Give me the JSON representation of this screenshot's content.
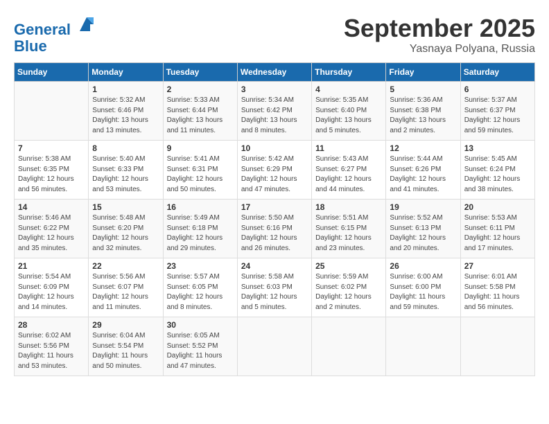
{
  "header": {
    "logo_line1": "General",
    "logo_line2": "Blue",
    "month": "September 2025",
    "location": "Yasnaya Polyana, Russia"
  },
  "days_of_week": [
    "Sunday",
    "Monday",
    "Tuesday",
    "Wednesday",
    "Thursday",
    "Friday",
    "Saturday"
  ],
  "weeks": [
    [
      {
        "day": "",
        "info": ""
      },
      {
        "day": "1",
        "info": "Sunrise: 5:32 AM\nSunset: 6:46 PM\nDaylight: 13 hours\nand 13 minutes."
      },
      {
        "day": "2",
        "info": "Sunrise: 5:33 AM\nSunset: 6:44 PM\nDaylight: 13 hours\nand 11 minutes."
      },
      {
        "day": "3",
        "info": "Sunrise: 5:34 AM\nSunset: 6:42 PM\nDaylight: 13 hours\nand 8 minutes."
      },
      {
        "day": "4",
        "info": "Sunrise: 5:35 AM\nSunset: 6:40 PM\nDaylight: 13 hours\nand 5 minutes."
      },
      {
        "day": "5",
        "info": "Sunrise: 5:36 AM\nSunset: 6:38 PM\nDaylight: 13 hours\nand 2 minutes."
      },
      {
        "day": "6",
        "info": "Sunrise: 5:37 AM\nSunset: 6:37 PM\nDaylight: 12 hours\nand 59 minutes."
      }
    ],
    [
      {
        "day": "7",
        "info": "Sunrise: 5:38 AM\nSunset: 6:35 PM\nDaylight: 12 hours\nand 56 minutes."
      },
      {
        "day": "8",
        "info": "Sunrise: 5:40 AM\nSunset: 6:33 PM\nDaylight: 12 hours\nand 53 minutes."
      },
      {
        "day": "9",
        "info": "Sunrise: 5:41 AM\nSunset: 6:31 PM\nDaylight: 12 hours\nand 50 minutes."
      },
      {
        "day": "10",
        "info": "Sunrise: 5:42 AM\nSunset: 6:29 PM\nDaylight: 12 hours\nand 47 minutes."
      },
      {
        "day": "11",
        "info": "Sunrise: 5:43 AM\nSunset: 6:27 PM\nDaylight: 12 hours\nand 44 minutes."
      },
      {
        "day": "12",
        "info": "Sunrise: 5:44 AM\nSunset: 6:26 PM\nDaylight: 12 hours\nand 41 minutes."
      },
      {
        "day": "13",
        "info": "Sunrise: 5:45 AM\nSunset: 6:24 PM\nDaylight: 12 hours\nand 38 minutes."
      }
    ],
    [
      {
        "day": "14",
        "info": "Sunrise: 5:46 AM\nSunset: 6:22 PM\nDaylight: 12 hours\nand 35 minutes."
      },
      {
        "day": "15",
        "info": "Sunrise: 5:48 AM\nSunset: 6:20 PM\nDaylight: 12 hours\nand 32 minutes."
      },
      {
        "day": "16",
        "info": "Sunrise: 5:49 AM\nSunset: 6:18 PM\nDaylight: 12 hours\nand 29 minutes."
      },
      {
        "day": "17",
        "info": "Sunrise: 5:50 AM\nSunset: 6:16 PM\nDaylight: 12 hours\nand 26 minutes."
      },
      {
        "day": "18",
        "info": "Sunrise: 5:51 AM\nSunset: 6:15 PM\nDaylight: 12 hours\nand 23 minutes."
      },
      {
        "day": "19",
        "info": "Sunrise: 5:52 AM\nSunset: 6:13 PM\nDaylight: 12 hours\nand 20 minutes."
      },
      {
        "day": "20",
        "info": "Sunrise: 5:53 AM\nSunset: 6:11 PM\nDaylight: 12 hours\nand 17 minutes."
      }
    ],
    [
      {
        "day": "21",
        "info": "Sunrise: 5:54 AM\nSunset: 6:09 PM\nDaylight: 12 hours\nand 14 minutes."
      },
      {
        "day": "22",
        "info": "Sunrise: 5:56 AM\nSunset: 6:07 PM\nDaylight: 12 hours\nand 11 minutes."
      },
      {
        "day": "23",
        "info": "Sunrise: 5:57 AM\nSunset: 6:05 PM\nDaylight: 12 hours\nand 8 minutes."
      },
      {
        "day": "24",
        "info": "Sunrise: 5:58 AM\nSunset: 6:03 PM\nDaylight: 12 hours\nand 5 minutes."
      },
      {
        "day": "25",
        "info": "Sunrise: 5:59 AM\nSunset: 6:02 PM\nDaylight: 12 hours\nand 2 minutes."
      },
      {
        "day": "26",
        "info": "Sunrise: 6:00 AM\nSunset: 6:00 PM\nDaylight: 11 hours\nand 59 minutes."
      },
      {
        "day": "27",
        "info": "Sunrise: 6:01 AM\nSunset: 5:58 PM\nDaylight: 11 hours\nand 56 minutes."
      }
    ],
    [
      {
        "day": "28",
        "info": "Sunrise: 6:02 AM\nSunset: 5:56 PM\nDaylight: 11 hours\nand 53 minutes."
      },
      {
        "day": "29",
        "info": "Sunrise: 6:04 AM\nSunset: 5:54 PM\nDaylight: 11 hours\nand 50 minutes."
      },
      {
        "day": "30",
        "info": "Sunrise: 6:05 AM\nSunset: 5:52 PM\nDaylight: 11 hours\nand 47 minutes."
      },
      {
        "day": "",
        "info": ""
      },
      {
        "day": "",
        "info": ""
      },
      {
        "day": "",
        "info": ""
      },
      {
        "day": "",
        "info": ""
      }
    ]
  ]
}
